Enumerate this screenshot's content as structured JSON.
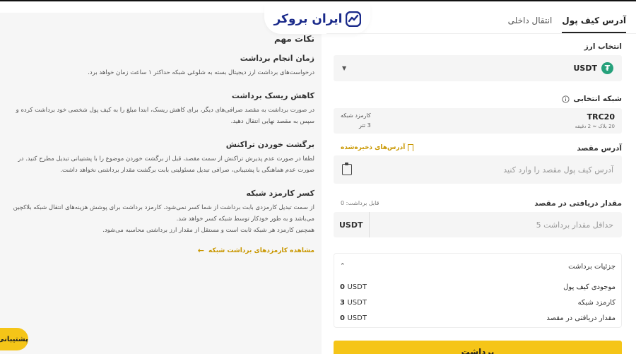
{
  "brand": {
    "logo_text": "ایران بروکر"
  },
  "tabs": [
    {
      "label": "آدرس کیف پول",
      "active": true
    },
    {
      "label": "انتقال داخلی",
      "active": false
    }
  ],
  "form": {
    "currency_label": "انتخاب ارز",
    "currency_value": "USDT",
    "currency_icon": "tether-icon",
    "network_label": "شبکه انتخابی",
    "network_name": "TRC20",
    "network_sub": "20 بلاک ≈ 2 دقیقه",
    "network_fee_label": "کارمزد شبکه",
    "network_fee_value": "3 تتر",
    "address_label": "آدرس مقصد",
    "saved_addresses": "آدرس‌های ذخیره‌شده",
    "address_placeholder": "آدرس کیف پول مقصد را وارد کنید",
    "amount_label": "مقدار دریافتی در مقصد",
    "available_text": "قابل برداشت: 0",
    "amount_placeholder": "حداقل مقدار برداشت 5",
    "amount_unit": "USDT",
    "details_title": "جزئیات برداشت",
    "details": [
      {
        "label": "موجودی کیف پول",
        "num": "0",
        "unit": "USDT"
      },
      {
        "label": "کارمزد شبکه",
        "num": "3",
        "unit": "USDT"
      },
      {
        "label": "مقدار دریافتی در مقصد",
        "num": "0",
        "unit": "USDT"
      }
    ],
    "submit_label": "برداشت"
  },
  "info": {
    "title": "نکات مهم",
    "sections": [
      {
        "heading": "زمان انجام برداشت",
        "text": "درخواست‌های برداشت ارز دیجیتال بسته به شلوغی شبکه حداکثر ۱ ساعت زمان خواهد برد."
      },
      {
        "heading": "کاهش ریسک برداشت",
        "text": "در صورت برداشت به مقصد صرافی‌های دیگر، برای کاهش ریسک، ابتدا مبلغ را به کیف پول شخصی خود برداشت کرده و سپس به مقصد نهایی انتقال دهید."
      },
      {
        "heading": "برگشت خوردن تراکنش",
        "text": "لطفا در صورت عدم پذیرش تراکنش از سمت مقصد، قبل از برگشت خوردن موضوع را با پشتیبانی تبدیل مطرح کنید. در صورت عدم هماهنگی با پشتیبانی، صرافی تبدیل مسئولیتی بابت برگشت مقدار برداشتی نخواهد داشت."
      },
      {
        "heading": "کسر کارمزد شبکه",
        "text": "از سمت تبدیل کارمزدی بابت برداشت از شما کسر نمی‌شود. کارمزد برداشت برای پوشش هزینه‌های انتقال شبکه بلاکچین می‌باشد و به طور خودکار توسط شبکه کسر خواهد شد.",
        "text2": "همچنین کارمزد هر شبکه ثابت است و مستقل از مقدار ارز برداشتی محاسبه می‌شود."
      }
    ],
    "link": "مشاهده کارمزدهای برداشت شبکه"
  },
  "support": {
    "label": "پشتیبانی"
  }
}
